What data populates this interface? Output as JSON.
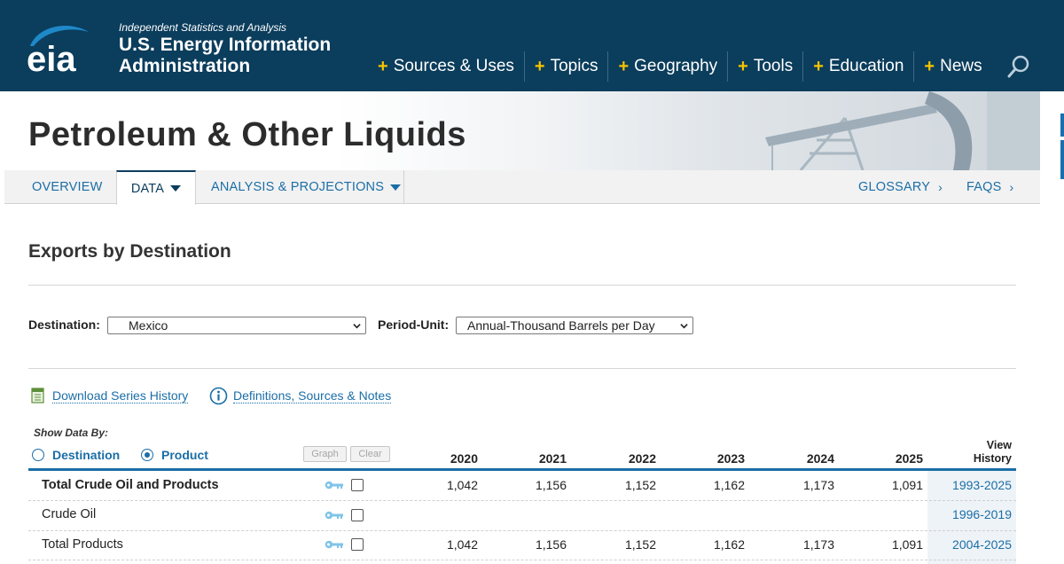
{
  "header": {
    "logo_text": "eia",
    "tagline": "Independent Statistics and Analysis",
    "org_name": "U.S. Energy Information Administration",
    "nav": [
      {
        "label": "Sources & Uses"
      },
      {
        "label": "Topics"
      },
      {
        "label": "Geography"
      },
      {
        "label": "Tools"
      },
      {
        "label": "Education"
      },
      {
        "label": "News"
      }
    ],
    "plus_glyph": "+",
    "search_icon": "search-icon"
  },
  "banner": {
    "title": "Petroleum & Other Liquids"
  },
  "tabs": {
    "overview": "OVERVIEW",
    "data": "DATA",
    "analysis": "ANALYSIS & PROJECTIONS",
    "glossary": "GLOSSARY",
    "faqs": "FAQS",
    "chevron": "›"
  },
  "content": {
    "section_title": "Exports by Destination",
    "filters": {
      "destination_label": "Destination:",
      "destination_value": "Mexico",
      "period_label": "Period-Unit:",
      "period_value": "Annual-Thousand Barrels per Day"
    },
    "links": {
      "download": "Download Series History",
      "definitions": "Definitions, Sources & Notes"
    },
    "show_data_by": {
      "label": "Show Data By:",
      "options": [
        {
          "label": "Destination",
          "checked": false
        },
        {
          "label": "Product",
          "checked": true
        }
      ]
    },
    "buttons": {
      "graph": "Graph",
      "clear": "Clear"
    }
  },
  "table": {
    "years": [
      "2020",
      "2021",
      "2022",
      "2023",
      "2024",
      "2025"
    ],
    "view_history_header": [
      "View",
      "History"
    ],
    "rows": [
      {
        "label": "Total Crude Oil and Products",
        "bold": true,
        "values": [
          "1,042",
          "1,156",
          "1,152",
          "1,162",
          "1,173",
          "1,091"
        ],
        "history": "1993-2025"
      },
      {
        "label": "Crude Oil",
        "bold": false,
        "values": [
          "",
          "",
          "",
          "",
          "",
          ""
        ],
        "history": "1996-2019"
      },
      {
        "label": "Total Products",
        "bold": false,
        "values": [
          "1,042",
          "1,156",
          "1,152",
          "1,162",
          "1,173",
          "1,091"
        ],
        "history": "2004-2025"
      }
    ]
  },
  "colors": {
    "header_bg": "#0b3d5c",
    "accent_yellow": "#f5c400",
    "link_blue": "#1b6ea6"
  }
}
